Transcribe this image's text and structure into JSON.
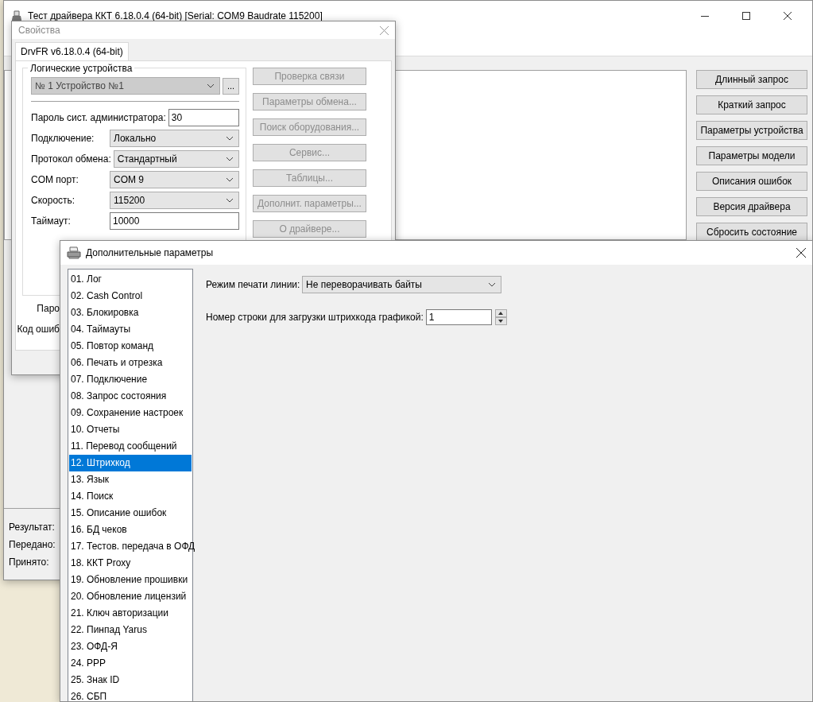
{
  "main_window": {
    "title": "Тест драйвера ККТ 6.18.0.4 (64-bit) [Serial: COM9 Baudrate 115200]",
    "buttons": [
      "Длинный запрос",
      "Краткий запрос",
      "Параметры устройства",
      "Параметры модели",
      "Описания ошибок",
      "Версия драйвера",
      "Сбросить состояние"
    ],
    "status_labels": [
      "Результат:",
      "Передано:",
      "Принято:"
    ]
  },
  "properties_dialog": {
    "title": "Свойства",
    "tab": {
      "label": "DrvFR v6.18.0.4 (64-bit)",
      "selected": true
    },
    "group_title": "Логические устройства",
    "device": {
      "value": "№ 1 Устройство №1",
      "disabled": true
    },
    "browse_button": "...",
    "fields": [
      {
        "kind": "input",
        "label": "Пароль сист. администратора:",
        "value": "30"
      },
      {
        "kind": "select",
        "label": "Подключение:",
        "value": "Локально"
      },
      {
        "kind": "select",
        "label": "Протокол обмена:",
        "value": "Стандартный"
      },
      {
        "kind": "select",
        "label": "COM порт:",
        "value": "COM 9"
      },
      {
        "kind": "select",
        "label": "Скорость:",
        "value": "115200"
      },
      {
        "kind": "input",
        "label": "Таймаут:",
        "value": "10000"
      }
    ],
    "buttons": [
      {
        "label": "Проверка связи",
        "disabled": true
      },
      {
        "label": "Параметры обмена...",
        "disabled": true
      },
      {
        "label": "Поиск оборудования...",
        "disabled": true
      },
      {
        "label": "Сервис...",
        "disabled": true
      },
      {
        "label": "Таблицы...",
        "disabled": true
      },
      {
        "label": "Дополнит. параметры...",
        "disabled": true
      },
      {
        "label": "О драйвере...",
        "disabled": true
      }
    ],
    "cut_labels": [
      "Паро",
      "Код ошиб"
    ]
  },
  "extra_dialog": {
    "title": "Дополнительные параметры",
    "sections": [
      {
        "label": "01. Лог",
        "selected": false
      },
      {
        "label": "02. Cash Control",
        "selected": false
      },
      {
        "label": "03. Блокировка",
        "selected": false
      },
      {
        "label": "04. Таймауты",
        "selected": false
      },
      {
        "label": "05. Повтор команд",
        "selected": false
      },
      {
        "label": "06. Печать и отрезка",
        "selected": false
      },
      {
        "label": "07. Подключение",
        "selected": false
      },
      {
        "label": "08. Запрос состояния",
        "selected": false
      },
      {
        "label": "09. Сохранение настроек",
        "selected": false
      },
      {
        "label": "10. Отчеты",
        "selected": false
      },
      {
        "label": "11. Перевод сообщений",
        "selected": false
      },
      {
        "label": "12. Штрихкод",
        "selected": true
      },
      {
        "label": "13. Язык",
        "selected": false
      },
      {
        "label": "14. Поиск",
        "selected": false
      },
      {
        "label": "15. Описание ошибок",
        "selected": false
      },
      {
        "label": "16. БД чеков",
        "selected": false
      },
      {
        "label": "17. Тестов. передача в ОФД",
        "selected": false
      },
      {
        "label": "18. ККТ Proxy",
        "selected": false
      },
      {
        "label": "19. Обновление прошивки",
        "selected": false
      },
      {
        "label": "20. Обновление лицензий",
        "selected": false
      },
      {
        "label": "21. Ключ авторизации",
        "selected": false
      },
      {
        "label": "22. Пинпад Yarus",
        "selected": false
      },
      {
        "label": "23. ОФД-Я",
        "selected": false
      },
      {
        "label": "24. PPP",
        "selected": false
      },
      {
        "label": "25. Знак ID",
        "selected": false
      },
      {
        "label": "26. СБП",
        "selected": false
      }
    ],
    "print_mode": {
      "label": "Режим печати линии:",
      "value": "Не переворачивать байты"
    },
    "barcode_line": {
      "label": "Номер строки для загрузки штрихкода графикой:",
      "value": "1"
    }
  }
}
